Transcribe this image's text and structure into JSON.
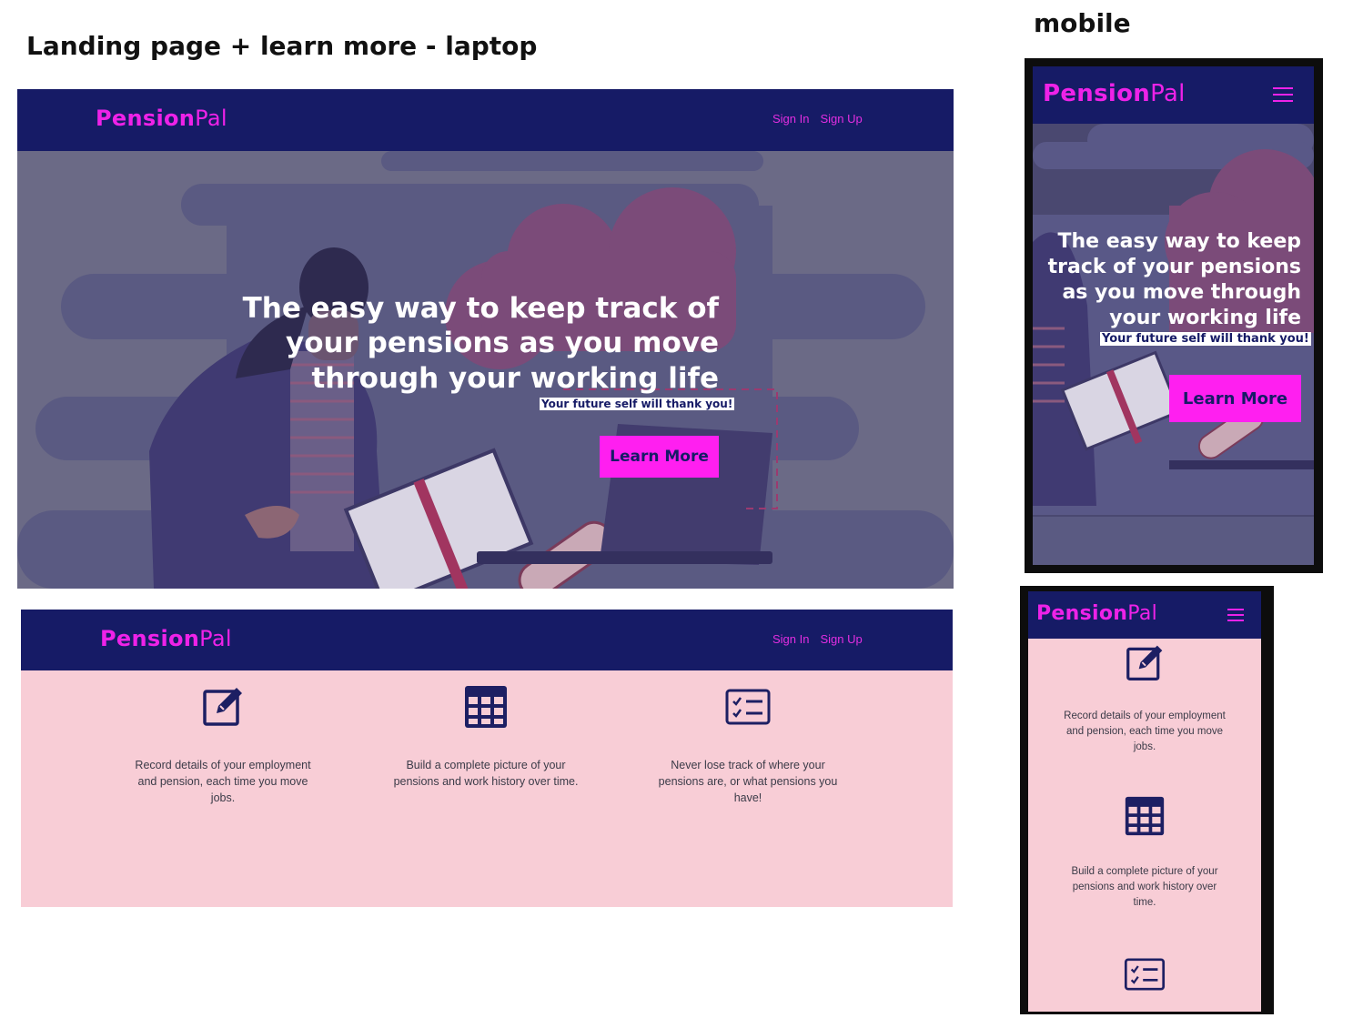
{
  "labels": {
    "laptop_heading": "Landing page + learn more - laptop",
    "mobile_heading": "mobile"
  },
  "brand": {
    "bold": "Pension",
    "light": "Pal"
  },
  "nav": {
    "sign_in": "Sign In",
    "sign_up": "Sign Up"
  },
  "hero": {
    "headline_laptop": [
      "The easy way to keep track of",
      "your pensions as you move",
      "through your working life"
    ],
    "headline_mobile": [
      "The easy way to keep",
      "track of your pensions",
      "as you move through",
      "your working life"
    ],
    "tagline": "Your future self will thank you!",
    "cta": "Learn More"
  },
  "features": [
    {
      "icon": "edit-icon",
      "text_lines_laptop": [
        "Record details of your employment",
        "and pension, each time you move",
        "jobs."
      ],
      "text_lines_mobile": [
        "Record details of your employment",
        "and pension, each time you move",
        "jobs."
      ]
    },
    {
      "icon": "table-icon",
      "text_lines_laptop": [
        "Build a complete picture of your",
        "pensions and work history over time."
      ],
      "text_lines_mobile": [
        "Build a complete picture of your",
        "pensions and work history over",
        "time."
      ]
    },
    {
      "icon": "checklist-icon",
      "text_lines_laptop": [
        "Never lose track of where your",
        "pensions are, or what pensions you",
        "have!"
      ],
      "text_lines_mobile": []
    }
  ],
  "colors": {
    "navbar": "#161b66",
    "brand_pink": "#ee22e8",
    "cta_bg": "#ff1ff0",
    "feature_bg": "#f8cdd6",
    "icon_navy": "#1d1f63"
  }
}
